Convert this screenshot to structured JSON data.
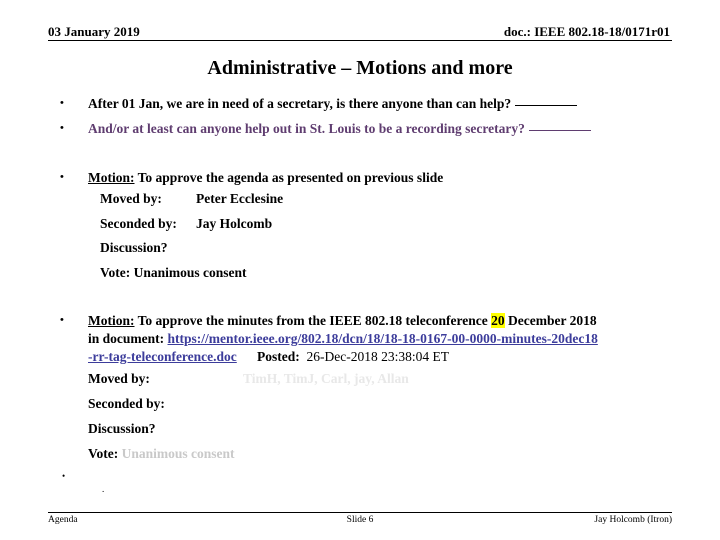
{
  "header": {
    "date": "03 January 2019",
    "doc_id": "doc.: IEEE 802.18-18/0171r01"
  },
  "title": "Administrative – Motions and more",
  "bullets": {
    "secretary_need": "After 01 Jan,  we are in need of a secretary, is there anyone than can help?",
    "recording_secretary": "And/or at least can anyone help out in St. Louis to be a recording secretary?"
  },
  "motion1": {
    "label": "Motion:",
    "text": "To approve the agenda as presented on previous slide",
    "moved_by_label": "Moved by:",
    "moved_by_value": "Peter Ecclesine",
    "seconded_by_label": "Seconded by:",
    "seconded_by_value": "Jay Holcomb",
    "discussion_label": "Discussion?",
    "vote_label": "Vote:",
    "vote_value": "Unanimous consent"
  },
  "motion2": {
    "label": "Motion:",
    "text_part1": "To approve the minutes from the IEEE 802.18 teleconference",
    "highlight": "20",
    "text_part2": "December 2018",
    "in_document_label": "in document:",
    "url_line1": "https://mentor.ieee.org/802.18/dcn/18/18-18-0167-00-0000-minutes-20dec18",
    "url_line2": "-rr-tag-teleconference.doc",
    "posted_label": "Posted:",
    "posted_value": "26-Dec-2018 23:38:04 ET",
    "moved_by_label": "Moved by:",
    "moved_by_value": "TimH, TimJ, Carl, jay, Allan",
    "seconded_by_label": "Seconded by:",
    "discussion_label": "Discussion?",
    "vote_label": "Vote:",
    "vote_value": "Unanimous consent"
  },
  "trailing_dots": {
    "dot1": "•",
    "dot2": "."
  },
  "footer": {
    "left": "Agenda",
    "center": "Slide 6",
    "right": "Jay Holcomb (Itron)"
  },
  "marks": {
    "bullet": "•"
  },
  "colors": {
    "purple": "#5f3d70",
    "link": "#3c3c9b",
    "highlight": "#ffff00",
    "faint": "#e8e8e8",
    "faint_mid": "#c9c9c9",
    "text": "#000000"
  }
}
